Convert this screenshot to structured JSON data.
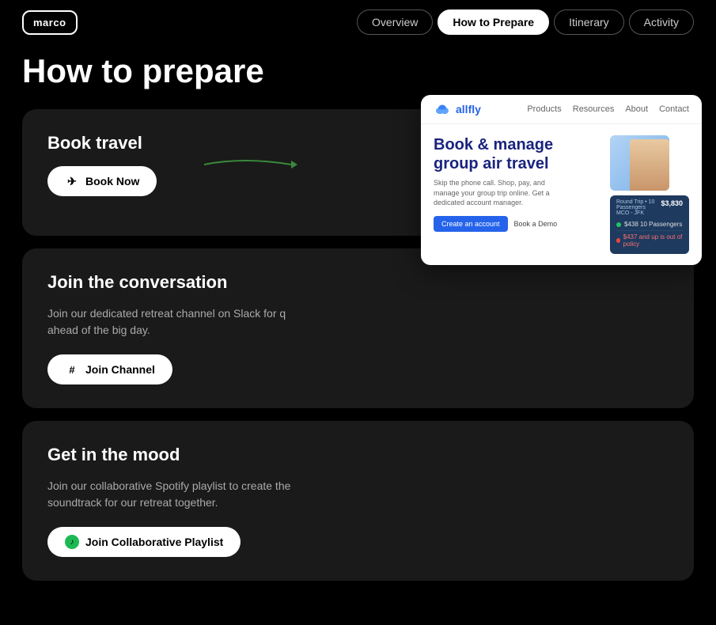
{
  "logo": {
    "text": "marco"
  },
  "nav": {
    "links": [
      {
        "id": "overview",
        "label": "Overview",
        "active": false
      },
      {
        "id": "how-to-prepare",
        "label": "How to Prepare",
        "active": true
      },
      {
        "id": "itinerary",
        "label": "Itinerary",
        "active": false
      },
      {
        "id": "activity",
        "label": "Activity",
        "active": false
      }
    ]
  },
  "page": {
    "title": "How to prepare",
    "cards": [
      {
        "id": "book-travel",
        "title": "Book travel",
        "desc": "",
        "button": {
          "label": "Book Now",
          "icon": "plane"
        }
      },
      {
        "id": "join-conversation",
        "title": "Join the conversation",
        "desc": "Join our dedicated retreat channel on Slack for q ahead of the big day.",
        "button": {
          "label": "Join Channel",
          "icon": "slack"
        }
      },
      {
        "id": "get-in-mood",
        "title": "Get in the mood",
        "desc": "Join our collaborative Spotify playlist to create the soundtrack for our retreat together.",
        "button": {
          "label": "Join Collaborative Playlist",
          "icon": "spotify"
        }
      }
    ]
  },
  "allfly": {
    "logo": "allfly",
    "nav_items": [
      "Products",
      "Resources",
      "About",
      "Contact"
    ],
    "headline_line1": "Book & manage",
    "headline_line2": "group air travel",
    "subtext": "Skip the phone call. Shop, pay, and manage your group trip online. Get a dedicated account manager.",
    "btn_primary": "Create an account",
    "btn_secondary": "Book a Demo",
    "card": {
      "trip_type": "Round Trip •",
      "passengers": "10 Passengers",
      "route": "MCO - JFK",
      "price": "$3,830",
      "rows": [
        {
          "label": "$438 10 Passengers",
          "status": "green"
        },
        {
          "label": "$437 and up is out of policy",
          "status": "red"
        }
      ]
    }
  }
}
